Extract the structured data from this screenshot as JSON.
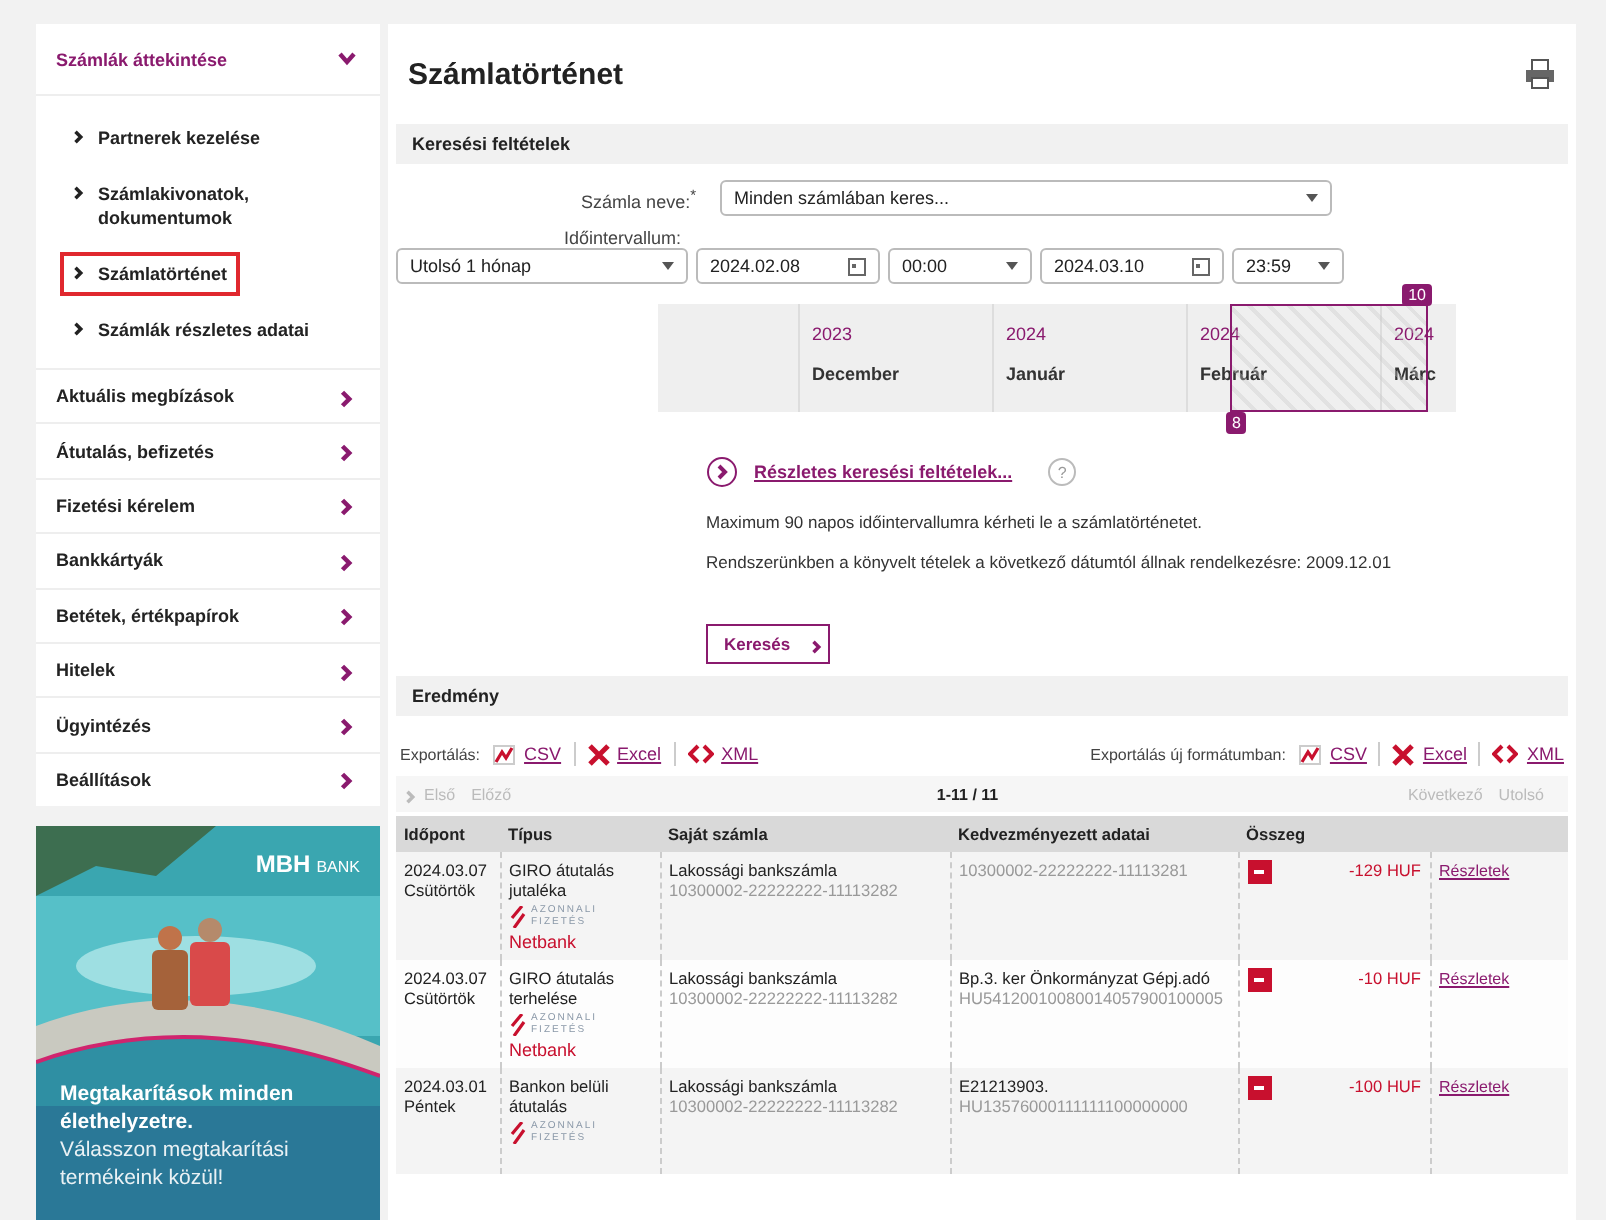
{
  "sidebar": {
    "section": {
      "title": "Számlák áttekintése",
      "expanded": true,
      "items": [
        {
          "label": "Partnerek kezelése",
          "selected": false
        },
        {
          "label": "Számlakivonatok, dokumentumok",
          "selected": false
        },
        {
          "label": "Számlatörténet",
          "selected": true
        },
        {
          "label": "Számlák részletes adatai",
          "selected": false
        }
      ]
    },
    "items": [
      {
        "label": "Aktuális megbízások"
      },
      {
        "label": "Átutalás, befizetés"
      },
      {
        "label": "Fizetési kérelem"
      },
      {
        "label": "Bankkártyák"
      },
      {
        "label": "Betétek, értékpapírok"
      },
      {
        "label": "Hitelek"
      },
      {
        "label": "Ügyintézés"
      },
      {
        "label": "Beállítások"
      }
    ],
    "banner": {
      "kind": "picture",
      "logo_main": "MBH",
      "logo_sub": "BANK",
      "headline": "Megtakarítások minden élethelyzetre.",
      "text": "Válasszon megtakarítási termékeink közül!"
    }
  },
  "page_title": "Számlatörténet",
  "search": {
    "title": "Keresési feltételek",
    "account_label": "Számla neve:",
    "required_mark": "*",
    "account_value": "Minden számlában keres...",
    "interval_label": "Időintervallum:",
    "period": "Utolsó 1 hónap",
    "from_date": "2024.02.08",
    "from_time": "00:00",
    "to_date": "2024.03.10",
    "to_time": "23:59",
    "timeline": [
      {
        "year": "2023",
        "month": "December"
      },
      {
        "year": "2024",
        "month": "Január"
      },
      {
        "year": "2024",
        "month": "Február"
      },
      {
        "year": "2024",
        "month": "Márc"
      }
    ],
    "range_start_badge": "8",
    "range_end_badge": "10",
    "advanced_link": "Részletes keresési feltételek...",
    "help": "?",
    "notes": [
      "Maximum 90 napos időintervallumra kérheti le a számlatörténetet.",
      "Rendszerünkben a könyvelt tételek a következő dátumtól állnak rendelkezésre: 2009.12.01"
    ],
    "button": "Keresés"
  },
  "results": {
    "title": "Eredmény",
    "export": {
      "label": "Exportálás:",
      "links": [
        {
          "kind": "csv",
          "label": "CSV"
        },
        {
          "kind": "excel",
          "label": "Excel"
        },
        {
          "kind": "xml",
          "label": "XML"
        }
      ]
    },
    "export_new": {
      "label": "Exportálás új formátumban:",
      "links": [
        {
          "kind": "csv",
          "label": "CSV"
        },
        {
          "kind": "excel",
          "label": "Excel"
        },
        {
          "kind": "xml",
          "label": "XML"
        }
      ]
    },
    "pager": {
      "first": "Első",
      "prev": "Előző",
      "range": "1-11 / 11",
      "next": "Következő",
      "last": "Utolsó",
      "disabled": true
    },
    "table": {
      "columns": [
        "Időpont",
        "Típus",
        "Saját számla",
        "Kedvezményezett adatai",
        "Összeg"
      ],
      "rows": [
        {
          "date": "2024.03.07",
          "day": "Csütörtök",
          "type": "GIRO átutalás jutaléka",
          "instant": [
            "AZONNALI",
            "FIZETÉS"
          ],
          "channel": "Netbank",
          "account": "Lakossági bankszámla",
          "account_no": "10300002-22222222-11113282",
          "payee": "",
          "payee_no": "10300002-22222222-11113281",
          "amount": "-129 HUF",
          "details": "Részletek"
        },
        {
          "date": "2024.03.07",
          "day": "Csütörtök",
          "type": "GIRO átutalás terhelése",
          "instant": [
            "AZONNALI",
            "FIZETÉS"
          ],
          "channel": "Netbank",
          "account": "Lakossági bankszámla",
          "account_no": "10300002-22222222-11113282",
          "payee": "Bp.3. ker Önkormányzat Gépj.adó",
          "payee_no": "HU54120010080014057900100005",
          "amount": "-10 HUF",
          "details": "Részletek"
        },
        {
          "date": "2024.03.01",
          "day": "Péntek",
          "type": "Bankon belüli átutalás",
          "instant": [
            "AZONNALI",
            "FIZETÉS"
          ],
          "channel": "",
          "account": "Lakossági bankszámla",
          "account_no": "10300002-22222222-11113282",
          "payee": "E21213903.",
          "payee_no": "HU13576000111111100000000",
          "amount": "-100 HUF",
          "details": "Részletek"
        }
      ]
    }
  }
}
